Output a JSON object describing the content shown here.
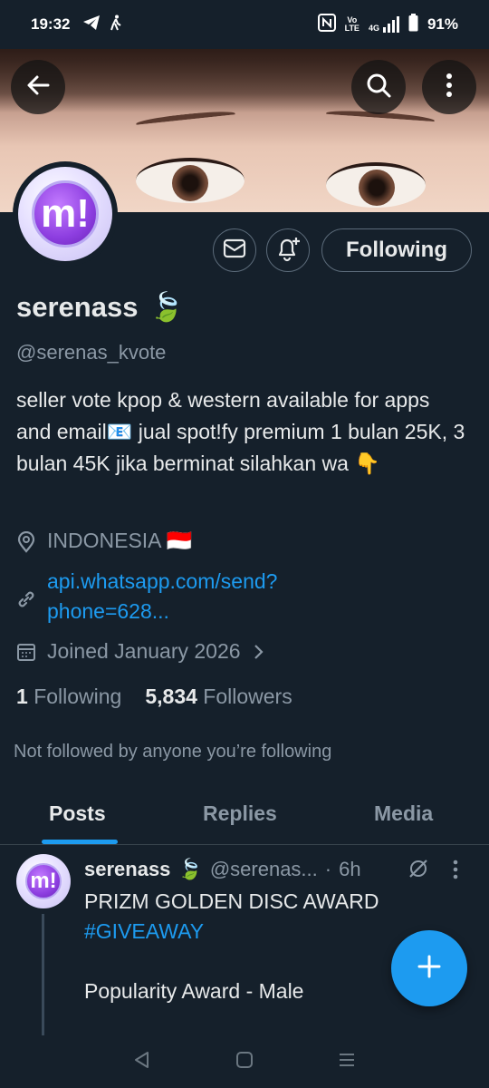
{
  "status_bar": {
    "time": "19:32",
    "battery": "91%",
    "volte_top": "Vo",
    "volte_bottom": "LTE",
    "net": "4G"
  },
  "profile": {
    "display_name": "serenass",
    "name_emoji": "🍃",
    "handle": "@serenas_kvote",
    "bio": "seller vote kpop & western available for apps and email📧 jual spot!fy premium 1 bulan 25K, 3 bulan 45K jika berminat silahkan wa 👇",
    "location": "INDONESIA 🇮🇩",
    "link_line1": "api.whatsapp.com/send?",
    "link_line2": "phone=628...",
    "joined": "Joined January 2026",
    "following_count": "1",
    "following_label": "Following",
    "followers_count": "5,834",
    "followers_label": "Followers",
    "not_followed": "Not followed by anyone you’re following",
    "avatar_letter": "m!"
  },
  "actions": {
    "following_button": "Following"
  },
  "tabs": [
    {
      "label": "Posts",
      "active": true
    },
    {
      "label": "Replies",
      "active": false
    },
    {
      "label": "Media",
      "active": false
    }
  ],
  "post": {
    "name": "serenass",
    "emoji": "🍃",
    "handle": "@serenas...",
    "sep": "·",
    "time": "6h",
    "line1": "PRIZM GOLDEN DISC AWARD",
    "hashtag": "#GIVEAWAY",
    "line3": "Popularity Award - Male"
  },
  "colors": {
    "background": "#15202b",
    "accent": "#1d9bf0",
    "secondary_text": "#8b98a5"
  },
  "icons": [
    "telegram-icon",
    "walking-icon",
    "nfc-icon",
    "signal-icon",
    "battery-icon",
    "back-arrow-icon",
    "search-icon",
    "more-vertical-icon",
    "mail-icon",
    "bell-plus-icon",
    "location-pin-icon",
    "link-icon",
    "calendar-icon",
    "chevron-right-icon",
    "grok-icon",
    "plus-icon",
    "nav-back-icon",
    "nav-home-icon",
    "nav-recents-icon"
  ]
}
